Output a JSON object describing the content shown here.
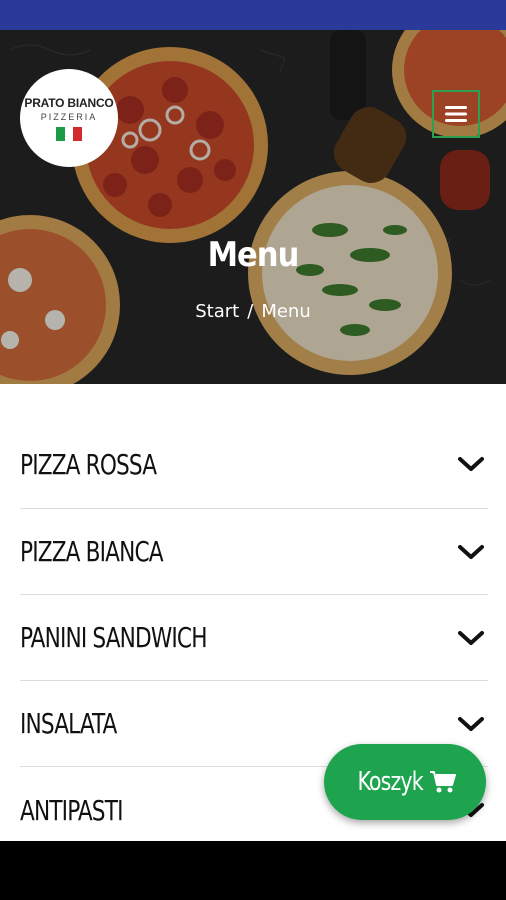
{
  "brand": {
    "name": "PRATO BIANCO",
    "subtitle": "PIZZERIA",
    "flag_colors": [
      "#1c9a46",
      "#ffffff",
      "#d22a2a"
    ]
  },
  "header": {
    "title": "Menu",
    "breadcrumb": {
      "home": "Start",
      "separator": "/",
      "current": "Menu"
    },
    "menu_icon": "hamburger-icon"
  },
  "menu": {
    "categories": [
      {
        "label": "PIZZA ROSSA",
        "icon": "chevron-down-icon"
      },
      {
        "label": "PIZZA BIANCA",
        "icon": "chevron-down-icon"
      },
      {
        "label": "PANINI SANDWICH",
        "icon": "chevron-down-icon"
      },
      {
        "label": "INSALATA",
        "icon": "chevron-down-icon"
      },
      {
        "label": "ANTIPASTI",
        "icon": "chevron-down-icon"
      }
    ]
  },
  "cart": {
    "label": "Koszyk",
    "icon": "shopping-cart-icon"
  },
  "colors": {
    "status_bar": "#2b3a9a",
    "accent_green": "#1ea34f",
    "text": "#111111"
  }
}
